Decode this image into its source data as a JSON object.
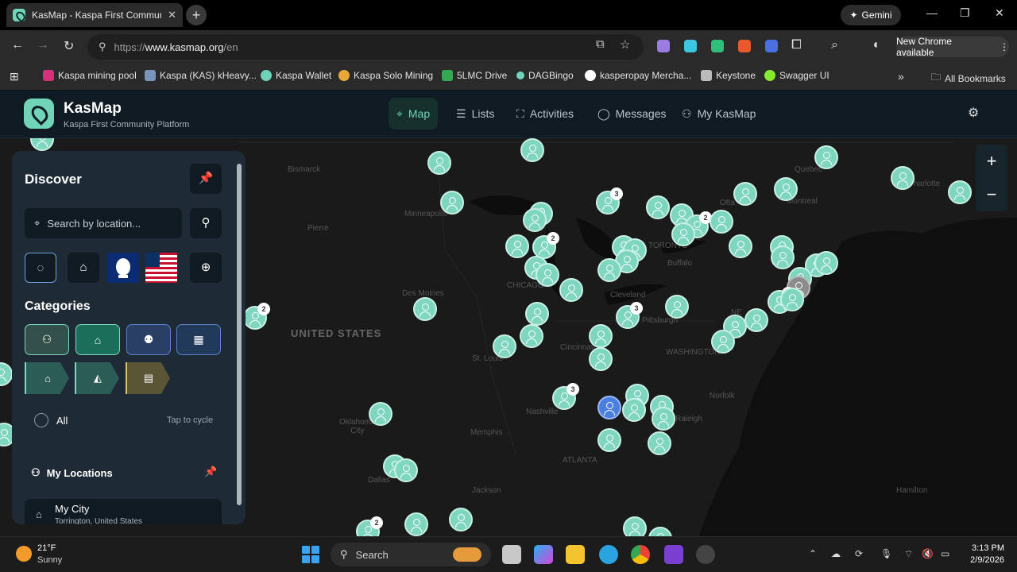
{
  "browser": {
    "tab_title": "KasMap - Kaspa First Community Platform",
    "gemini_label": "Gemini",
    "url_prefix": "https://",
    "url_host": "www.kasmap.org",
    "url_path": "/en",
    "update_label": "New Chrome available",
    "bookmarks": [
      {
        "label": "Kaspa mining pool",
        "color": "#d4317a"
      },
      {
        "label": "Kaspa (KAS) kHeavy...",
        "color": "#7b95b8"
      },
      {
        "label": "Kaspa Wallet",
        "color": "#6fd4b8"
      },
      {
        "label": "Kaspa Solo Mining",
        "color": "#e8a93a"
      },
      {
        "label": "5LMC Drive",
        "color": "#34a853"
      },
      {
        "label": "DAGBingo",
        "color": "#6fd4b8"
      },
      {
        "label": "kasperopay Mercha...",
        "color": "#ffffff"
      },
      {
        "label": "Keystone",
        "color": "#bbbbbb"
      },
      {
        "label": "Swagger UI",
        "color": "#85ea2d"
      }
    ],
    "all_bookmarks_label": "All Bookmarks"
  },
  "app": {
    "brand": "KasMap",
    "subtitle": "Kaspa First Community Platform",
    "nav": [
      {
        "label": "Map",
        "icon": "map-pin-icon",
        "active": true
      },
      {
        "label": "Lists",
        "icon": "list-icon",
        "active": false
      },
      {
        "label": "Activities",
        "icon": "activities-icon",
        "active": false
      },
      {
        "label": "Messages",
        "icon": "message-icon",
        "active": false
      },
      {
        "label": "My KasMap",
        "icon": "user-icon",
        "active": false
      }
    ],
    "accent_color": "#6fd4b8"
  },
  "map": {
    "labels": {
      "united_states": "UNITED STATES",
      "bismarck": "Bismarck",
      "pierre": "Pierre",
      "minneapolis": "Minneapolis",
      "des_moines": "Des Moines",
      "chicago": "CHICAGO",
      "st_louis": "St. Louis",
      "cincinnati": "Cincinnati",
      "cleveland": "Cleveland",
      "pittsburgh": "Pittsburgh",
      "washington": "WASHINGTON",
      "norfolk": "Norfolk",
      "raleigh": "Raleigh",
      "nashville": "Nashville",
      "memphis": "Memphis",
      "atlanta": "ATLANTA",
      "jackson": "Jackson",
      "dallas": "Dallas",
      "oklahoma_city": "Oklahoma\nCity",
      "toronto": "TORONTO",
      "buffalo": "Buffalo",
      "ottawa": "Otta",
      "montreal": "Montreal",
      "quebec": "Quebec",
      "charlottetown": "harlotte",
      "hamilton": "Hamilton",
      "new_york": "NE"
    },
    "zoom_in": "+",
    "zoom_out": "−"
  },
  "panel": {
    "title": "Discover",
    "search_placeholder": "Search by location...",
    "categories_title": "Categories",
    "all_label": "All",
    "tap_hint": "Tap to cycle",
    "my_locations_title": "My Locations",
    "city_name": "My City",
    "city_sub": "Torrington, United States"
  },
  "taskbar": {
    "temperature": "21°F",
    "condition": "Sunny",
    "search_label": "Search",
    "time": "3:13 PM",
    "date": "2/9/2026"
  }
}
